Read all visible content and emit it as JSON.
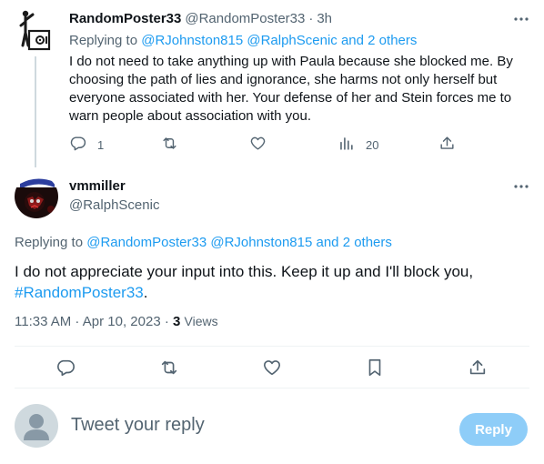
{
  "reply_tweet": {
    "display_name": "RandomPoster33",
    "handle": "@RandomPoster33",
    "separator": "·",
    "time": "3h",
    "replying_prefix": "Replying to",
    "replying_links": "@RJohnston815 @RalphScenic",
    "replying_and": "and",
    "replying_others": "2 others",
    "text": "I do not need to take anything up with Paula because she blocked me. By choosing the path of lies and ignorance, she harms not only herself but everyone associated with her. Your defense of her and Stein forces me to warn people about association with you.",
    "actions": {
      "replies": "1",
      "views": "20"
    }
  },
  "main_tweet": {
    "display_name": "vmmiller",
    "handle": "@RalphScenic",
    "replying_prefix": "Replying to",
    "replying_links": "@RandomPoster33 @RJohnston815",
    "replying_and": "and",
    "replying_others": "2 others",
    "text_main": "I do not appreciate your input into this. Keep it up and I'll block you,",
    "text_hashtag": "#RandomPoster33",
    "text_end": ".",
    "timestamp": "11:33 AM · Apr 10, 2023",
    "meta_separator": "·",
    "views_count": "3",
    "views_label": "Views"
  },
  "compose": {
    "placeholder": "Tweet your reply",
    "button_label": "Reply"
  },
  "colors": {
    "accent": "#1d9bf0",
    "secondary_text": "#536471",
    "reply_button_disabled": "#8ecdf8"
  },
  "icons": [
    "more-icon",
    "reply-icon",
    "retweet-icon",
    "like-icon",
    "views-icon",
    "share-icon",
    "bookmark-icon",
    "user-placeholder-icon"
  ]
}
